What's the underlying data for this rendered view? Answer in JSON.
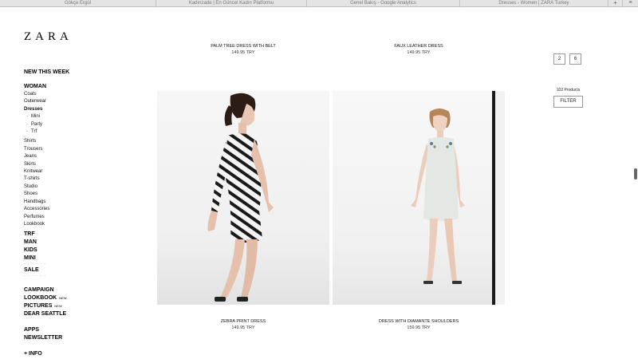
{
  "browser": {
    "tabs": [
      {
        "label": "Gökçe Ergül"
      },
      {
        "label": "Kadınzade | En Güncel Kadın Platformu"
      },
      {
        "label": "Genel Bakış - Google Analytics"
      },
      {
        "label": "Dresses - Women | ZARA Turkey"
      }
    ],
    "new_tab_label": "+",
    "tab_list_label": "≡"
  },
  "logo": "ZARA",
  "sidebar": {
    "new_this_week": "NEW THIS WEEK",
    "woman": "WOMAN",
    "woman_items": [
      "Coats",
      "Outerwear",
      "Dresses"
    ],
    "dress_sub": [
      "Mini",
      "Party",
      "Trf"
    ],
    "woman_items_2": [
      "Shirts",
      "Trousers",
      "Jeans",
      "Skirts",
      "Knitwear",
      "T-shirts",
      "Studio",
      "Shoes",
      "Handbags",
      "Accessories",
      "Perfumes",
      "Lookbook"
    ],
    "major_1": [
      "TRF",
      "MAN",
      "KIDS",
      "MINI"
    ],
    "sale": "SALE",
    "campaign": "CAMPAIGN",
    "lookbook": "LOOKBOOK",
    "pictures": "PICTURES",
    "new_badge": "NEW",
    "dear_seattle": "DEAR SEATTLE",
    "apps": "APPS",
    "newsletter": "NEWSLETTER",
    "info": "+ INFO",
    "dots": "· · · · · ·"
  },
  "products": [
    {
      "name": "PALM TREE DRESS WITH BELT",
      "price": "149.95 TRY"
    },
    {
      "name": "FAUX LEATHER DRESS",
      "price": "149.95 TRY"
    },
    {
      "name": "ZEBRA PRINT DRESS",
      "price": "149.95 TRY"
    },
    {
      "name": "DRESS WITH DIAMANTE SHOULDERS",
      "price": "159.95 TRY"
    }
  ],
  "view_options": [
    "2",
    "6"
  ],
  "products_count": "102 Products",
  "filter_label": "FILTER"
}
